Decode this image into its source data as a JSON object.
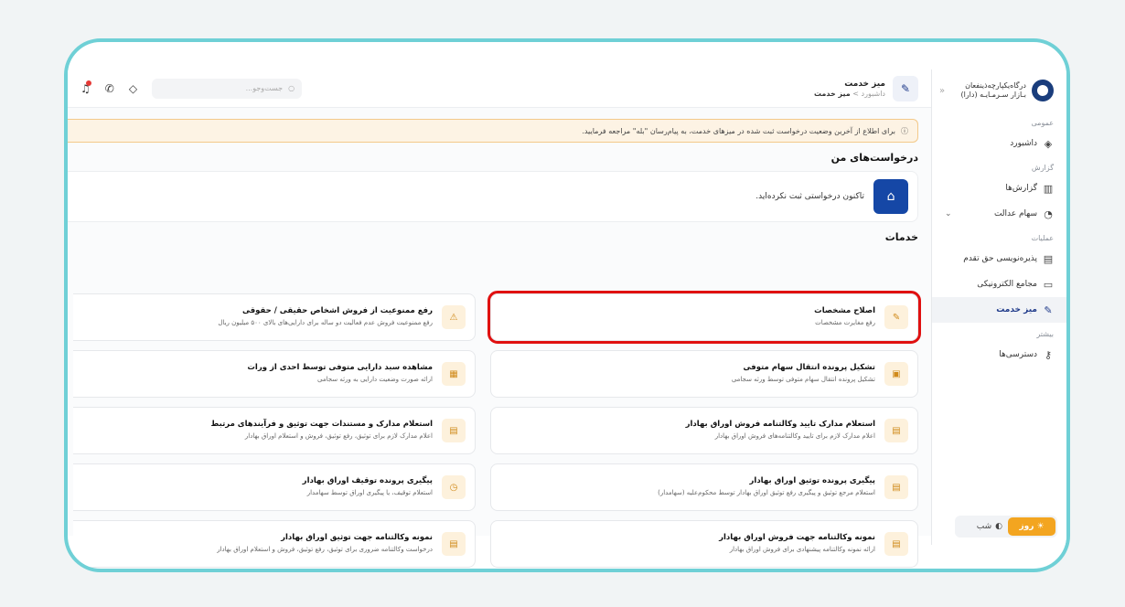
{
  "brand": {
    "line1": "درگاه‌یکپارچه‌ذینفعان",
    "line2": "بـازار سـرمـایـه (دارا)"
  },
  "sidebar": {
    "sections": {
      "general": "عمومی",
      "report": "گزارش",
      "ops": "عملیات",
      "more": "بیشتر"
    },
    "items": {
      "dashboard": "داشبورد",
      "reports": "گزارش‌ها",
      "edalat": "سهام عدالت",
      "preemption": "پذیره‌نویسی حق تقدم",
      "assemblies": "مجامع الکترونیکی",
      "service_desk": "میز خدمت",
      "access": "دسترسی‌ها"
    },
    "theme": {
      "day": "روز",
      "night": "شب"
    }
  },
  "topbar": {
    "title": "میز خدمت",
    "crumb_home": "داشبورد",
    "crumb_sep": ">",
    "crumb_current": "میز خدمت",
    "search_placeholder": "جست‌وجو..."
  },
  "alert": "برای اطلاع از آخرین وضعیت درخواست ثبت شده در میزهای خدمت، به پیام‌رسان \"بله\" مراجعه فرمایید.",
  "requests": {
    "heading": "درخواست‌های من",
    "empty": "تاکنون درخواستی ثبت نکرده‌اید."
  },
  "services": {
    "heading": "خدمات",
    "cards": [
      {
        "title": "اصلاح مشخصات",
        "desc": "رفع مغایرت مشخصات",
        "icon": "user-edit-icon"
      },
      {
        "title": "رفع ممنوعیت از فروش اشخاص حقیقی / حقوقی",
        "desc": "رفع ممنوعیت فروش عدم فعالیت دو ساله برای دارایی‌های بالای ۵۰۰ میلیون ریال",
        "icon": "warning-icon"
      },
      {
        "title": "تشکیل پرونده انتقال سهام متوفی",
        "desc": "تشکیل پرونده انتقال سهام متوفی توسط ورثه سجامی",
        "icon": "folder-icon"
      },
      {
        "title": "مشاهده سبد دارایی متوفی توسط احدی از ورات",
        "desc": "ارائه صورت وضعیت دارایی به ورثه سجامی",
        "icon": "portfolio-icon"
      },
      {
        "title": "استعلام مدارک تایید وکالتنامه فروش اوراق بهادار",
        "desc": "اعلام مدارک لازم برای تایید وکالتنامه‌های فروش اوراق بهادار",
        "icon": "document-lock-icon"
      },
      {
        "title": "استعلام مدارک و مستندات جهت توثیق و فرآیندهای مرتبط",
        "desc": "اعلام مدارک لازم برای توثیق، رفع توثیق، فروش و استعلام اوراق بهادار",
        "icon": "document-search-icon"
      },
      {
        "title": "پیگیری پرونده توثیق اوراق بهادار",
        "desc": "استعلام مرجع توثیق و پیگیری رفع توثیق اوراق بهادار توسط محکوم‌علیه (سهامدار)",
        "icon": "document-pin-icon"
      },
      {
        "title": "پیگیری پرونده توقیف اوراق بهادار",
        "desc": "استعلام توقیف، یا پیگیری اوراق توسط سهامدار",
        "icon": "clock-icon"
      },
      {
        "title": "نمونه وکالتنامه جهت فروش اوراق بهادار",
        "desc": "ارائه نمونه وکالتنامه پیشنهادی برای فروش اوراق بهادار",
        "icon": "document-icon"
      },
      {
        "title": "نمونه وکالتنامه جهت توثیق اوراق بهادار",
        "desc": "درخواست وکالتنامه ضروری برای توثیق، رفع توثیق، فروش و استعلام اوراق بهادار",
        "icon": "document-lock-icon"
      }
    ]
  },
  "colors": {
    "accent": "#1f3a8a",
    "frame": "#6fd0d6",
    "highlight": "#e01010",
    "warn_bg": "#fdf3e4"
  }
}
